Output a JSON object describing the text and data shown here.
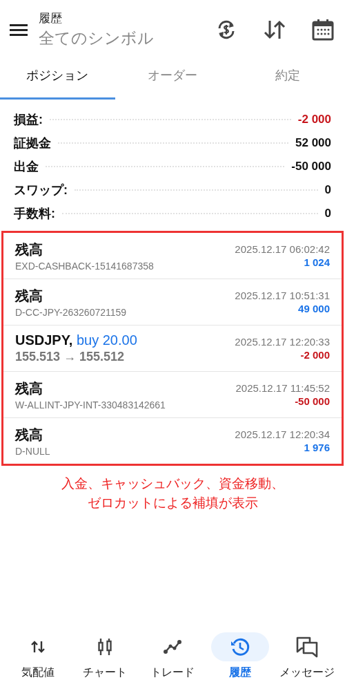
{
  "header": {
    "title": "履歴",
    "subtitle": "全てのシンボル"
  },
  "tabs": [
    {
      "label": "ポジション",
      "selected": true
    },
    {
      "label": "オーダー",
      "selected": false
    },
    {
      "label": "約定",
      "selected": false
    }
  ],
  "summary": [
    {
      "label": "損益:",
      "value": "-2 000",
      "color": "#c7161c"
    },
    {
      "label": "証拠金",
      "value": "52 000",
      "color": "#111111"
    },
    {
      "label": "出金",
      "value": "-50 000",
      "color": "#111111"
    },
    {
      "label": "スワップ:",
      "value": "0",
      "color": "#111111"
    },
    {
      "label": "手数料:",
      "value": "0",
      "color": "#111111"
    }
  ],
  "history": [
    {
      "kind": "balance",
      "title": "残高",
      "comment": "EXD-CASHBACK-15141687358",
      "time": "2025.12.17 06:02:42",
      "amount": "1 024",
      "color": "#1a73e8"
    },
    {
      "kind": "balance",
      "title": "残高",
      "comment": "D-CC-JPY-263260721159",
      "time": "2025.12.17 10:51:31",
      "amount": "49 000",
      "color": "#1a73e8"
    },
    {
      "kind": "trade",
      "title": "USDJPY,",
      "side": "buy 20.00",
      "prices": "155.513 → 155.512",
      "time": "2025.12.17 12:20:33",
      "amount": "-2 000",
      "color": "#c7161c"
    },
    {
      "kind": "balance",
      "title": "残高",
      "comment": "W-ALLINT-JPY-INT-330483142661",
      "time": "2025.12.17 11:45:52",
      "amount": "-50 000",
      "color": "#c7161c"
    },
    {
      "kind": "balance",
      "title": "残高",
      "comment": "D-NULL",
      "time": "2025.12.17 12:20:34",
      "amount": "1 976",
      "color": "#1a73e8"
    }
  ],
  "annotation": [
    "入金、キャッシュバック、資金移動、",
    "ゼロカットによる補填が表示"
  ],
  "bottom_nav": [
    {
      "label": "気配値",
      "selected": false
    },
    {
      "label": "チャート",
      "selected": false
    },
    {
      "label": "トレード",
      "selected": false
    },
    {
      "label": "履歴",
      "selected": true
    },
    {
      "label": "メッセージ",
      "selected": false
    }
  ]
}
